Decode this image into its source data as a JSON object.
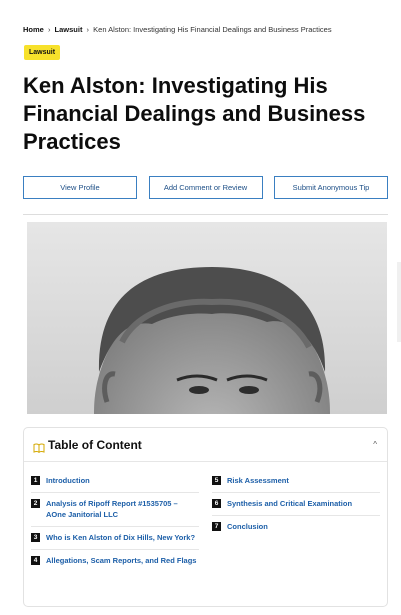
{
  "breadcrumb": {
    "home": "Home",
    "section": "Lawsuit",
    "current": "Ken Alston: Investigating His Financial Dealings and Business Practices",
    "separator": "›"
  },
  "badge": "Lawsuit",
  "title": "Ken Alston: Investigating His Financial Dealings and Business Practices",
  "actions": {
    "view_profile": "View Profile",
    "add_comment": "Add Comment or Review",
    "submit_tip": "Submit Anonymous Tip"
  },
  "toc": {
    "title": "Table of Content",
    "caret": "^",
    "items": [
      {
        "num": "1",
        "label": "Introduction"
      },
      {
        "num": "2",
        "label": "Analysis of Ripoff Report #1535705 – AOne Janitorial LLC"
      },
      {
        "num": "3",
        "label": "Who is Ken Alston of Dix Hills, New York?"
      },
      {
        "num": "4",
        "label": "Allegations, Scam Reports, and Red Flags"
      },
      {
        "num": "5",
        "label": "Risk Assessment"
      },
      {
        "num": "6",
        "label": "Synthesis and Critical Examination"
      },
      {
        "num": "7",
        "label": "Conclusion"
      }
    ]
  },
  "colors": {
    "badge": "#f7e12b",
    "link": "#1d5fa8",
    "button_border": "#3a7fc1"
  }
}
